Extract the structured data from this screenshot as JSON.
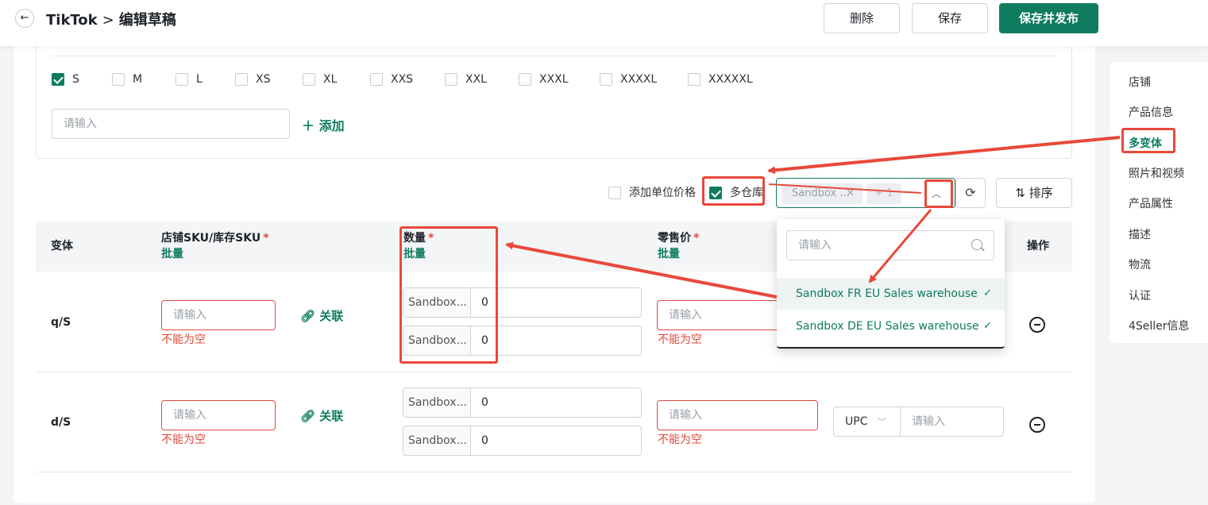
{
  "header": {
    "app": "TikTok",
    "separator": ">",
    "page_title": "编辑草稿",
    "buttons": {
      "delete": "删除",
      "save": "保存",
      "publish": "保存并发布"
    }
  },
  "sizes": {
    "options": [
      {
        "label": "S",
        "checked": true
      },
      {
        "label": "M",
        "checked": false
      },
      {
        "label": "L",
        "checked": false
      },
      {
        "label": "XS",
        "checked": false
      },
      {
        "label": "XL",
        "checked": false
      },
      {
        "label": "XXS",
        "checked": false
      },
      {
        "label": "XXL",
        "checked": false
      },
      {
        "label": "XXXL",
        "checked": false
      },
      {
        "label": "XXXXL",
        "checked": false
      },
      {
        "label": "XXXXXL",
        "checked": false
      }
    ],
    "custom_placeholder": "请输入",
    "add_label": "添加"
  },
  "toolbar": {
    "unit_price_label": "添加单位价格",
    "multi_warehouse_label": "多仓库",
    "selected_tag": "Sandbox ...",
    "more_tag": "+ 1",
    "sort_label": "排序"
  },
  "table": {
    "headers": {
      "variant": "变体",
      "sku": "店铺SKU/库存SKU",
      "qty": "数量",
      "price": "零售价",
      "bulk": "批量",
      "required": "*",
      "action": "操作"
    },
    "rows": [
      {
        "variant": "q/S",
        "sku_placeholder": "请输入",
        "error": "不能为空",
        "link_label": "关联",
        "warehouses": [
          {
            "name": "Sandbox...",
            "qty": "0"
          },
          {
            "name": "Sandbox...",
            "qty": "0"
          }
        ],
        "price_placeholder": "请输入",
        "price_error": "不能为空"
      },
      {
        "variant": "d/S",
        "sku_placeholder": "请输入",
        "error": "不能为空",
        "link_label": "关联",
        "warehouses": [
          {
            "name": "Sandbox...",
            "qty": "0"
          },
          {
            "name": "Sandbox...",
            "qty": "0"
          }
        ],
        "price_placeholder": "请输入",
        "price_error": "不能为空",
        "code_type": "UPC",
        "code_placeholder": "请输入"
      }
    ]
  },
  "dropdown": {
    "search_placeholder": "请输入",
    "options": [
      "Sandbox FR EU Sales warehouse",
      "Sandbox DE EU Sales warehouse"
    ],
    "check": "✓"
  },
  "sidenav": {
    "items": [
      "店铺",
      "产品信息",
      "多变体",
      "照片和视频",
      "产品属性",
      "描述",
      "物流",
      "认证",
      "4Seller信息"
    ],
    "active": "多变体"
  },
  "colors": {
    "brand": "#0f7c5f",
    "error": "#e0493b",
    "annotation": "#e8483a"
  }
}
